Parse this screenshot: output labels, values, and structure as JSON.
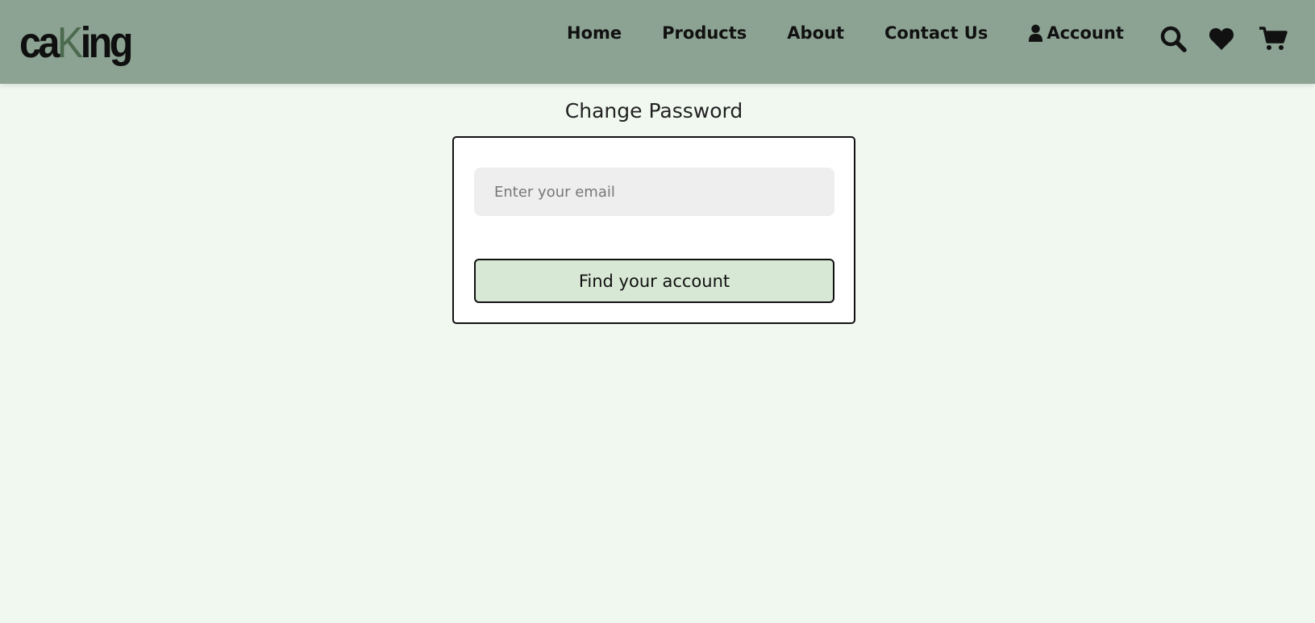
{
  "header": {
    "logo": {
      "part1": "ca",
      "part2": "K",
      "part3": "ing"
    },
    "nav": [
      {
        "label": "Home"
      },
      {
        "label": "Products"
      },
      {
        "label": "About"
      },
      {
        "label": "Contact Us"
      },
      {
        "label": "Account",
        "icon": "user-icon"
      }
    ],
    "icons": [
      "search-icon",
      "heart-icon",
      "cart-icon"
    ]
  },
  "main": {
    "title": "Change Password",
    "email_placeholder": "Enter your email",
    "email_value": "",
    "submit_label": "Find your account"
  },
  "colors": {
    "header_bg": "#8ca292",
    "page_bg": "#f1f8f0",
    "logo_accent": "#4b6a4e",
    "button_bg": "#d7e8d4",
    "input_bg": "#eeeeee"
  }
}
